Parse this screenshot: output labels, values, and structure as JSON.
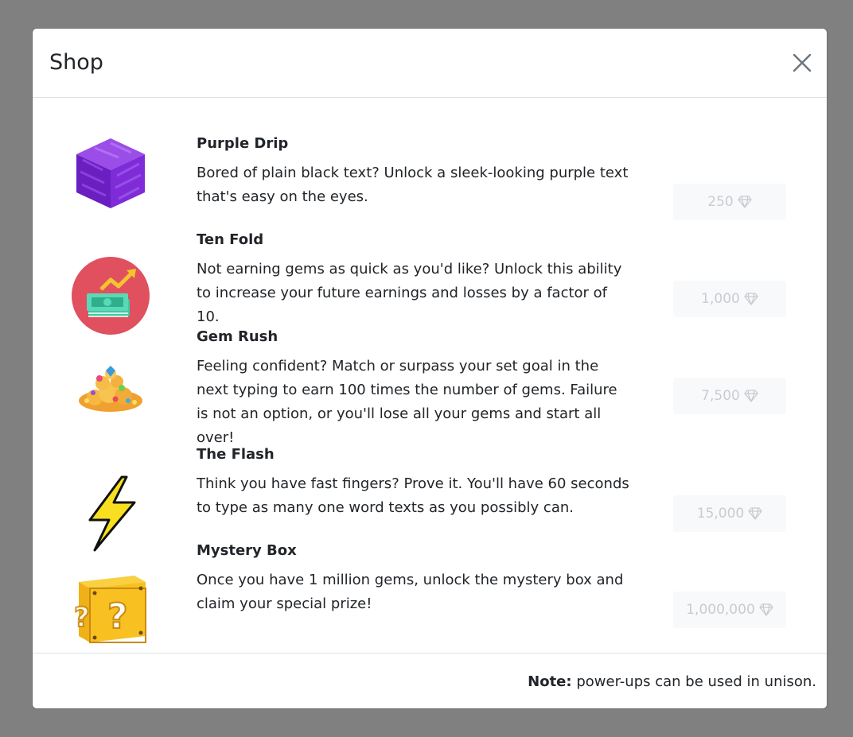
{
  "modal": {
    "title": "Shop",
    "footer_note_label": "Note:",
    "footer_note_text": "power-ups can be used in unison."
  },
  "items": [
    {
      "name": "Purple Drip",
      "description": "Bored of plain black text? Unlock a sleek-looking purple text that's easy on the eyes.",
      "price": "250",
      "icon": "purple-cube-icon"
    },
    {
      "name": "Ten Fold",
      "description": "Not earning gems as quick as you'd like? Unlock this ability to increase your future earnings and losses by a factor of 10.",
      "price": "1,000",
      "icon": "money-growth-icon"
    },
    {
      "name": "Gem Rush",
      "description": "Feeling confident? Match or surpass your set goal in the next typing to earn 100 times the number of gems. Failure is not an option, or you'll lose all your gems and start all over!",
      "price": "7,500",
      "icon": "treasure-pile-icon"
    },
    {
      "name": "The Flash",
      "description": "Think you have fast fingers? Prove it. You'll have 60 seconds to type as many one word texts as you possibly can.",
      "price": "15,000",
      "icon": "lightning-bolt-icon"
    },
    {
      "name": "Mystery Box",
      "description": "Once you have 1 million gems, unlock the mystery box and claim your special prize!",
      "price": "1,000,000",
      "icon": "mystery-box-icon"
    }
  ],
  "colors": {
    "overlay": "#808080",
    "price_bg": "#f8f9fb",
    "price_text": "#c8ccd0"
  }
}
